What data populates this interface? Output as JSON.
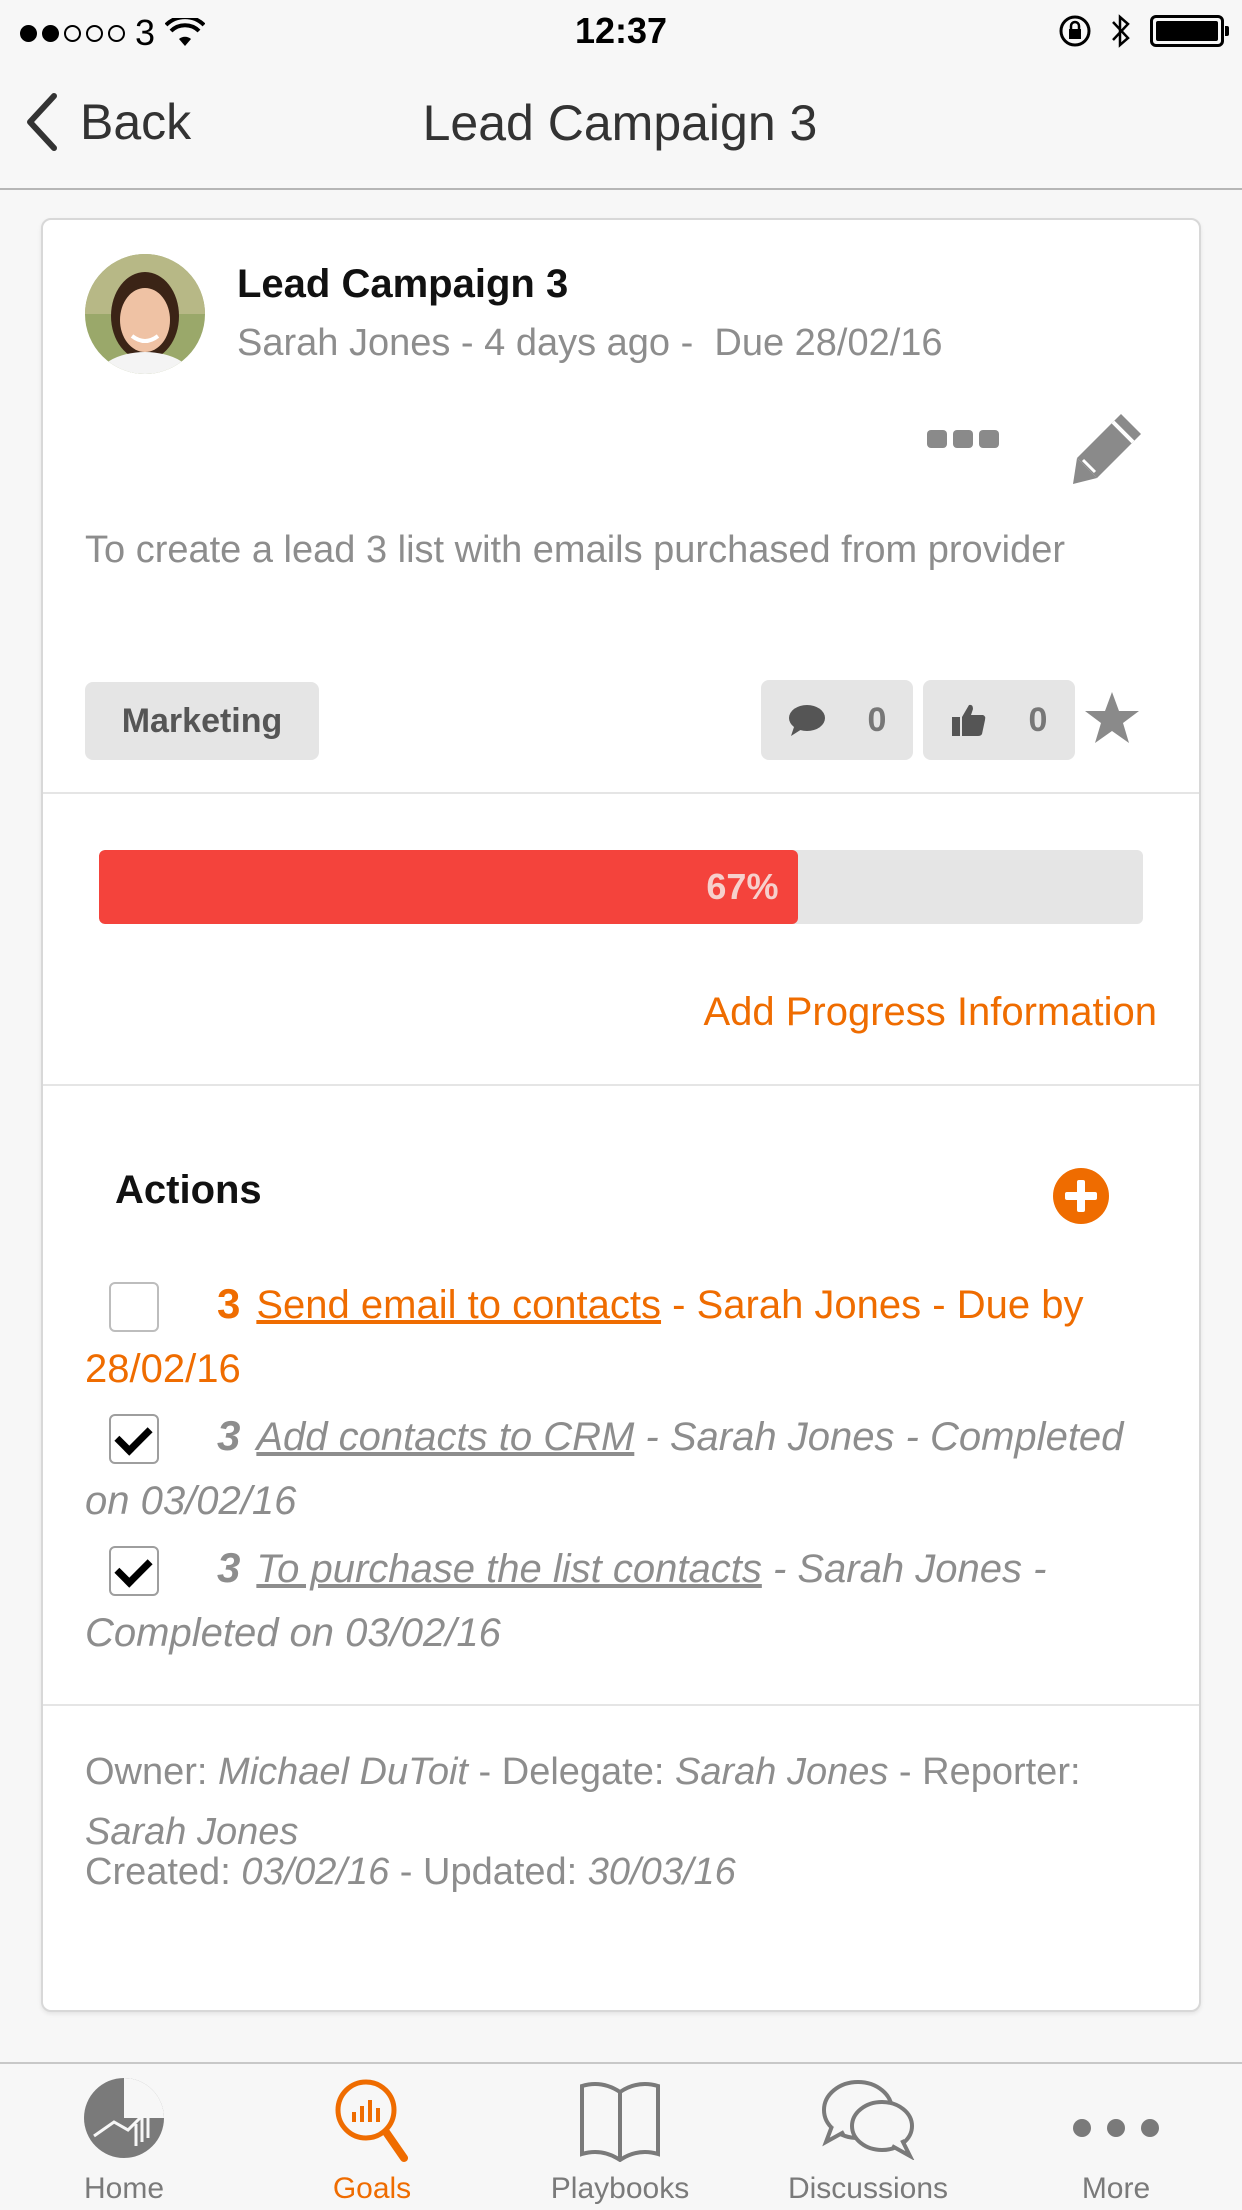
{
  "status_bar": {
    "carrier": "3",
    "time": "12:37"
  },
  "nav": {
    "back_label": "Back",
    "title": "Lead Campaign 3"
  },
  "goal": {
    "title": "Lead Campaign 3",
    "meta": "Sarah Jones - 4 days ago -  Due 28/02/16",
    "description": "To create a lead 3 list with emails purchased from provider",
    "tag": "Marketing",
    "comment_count": "0",
    "like_count": "0",
    "progress": {
      "percent": 67,
      "label": "67%"
    },
    "add_progress_label": "Add Progress Information"
  },
  "actions": {
    "title": "Actions",
    "items": [
      {
        "number": "3",
        "title": "Send email to contacts",
        "detail": " - Sarah Jones - Due by 28/02/16",
        "checked": false
      },
      {
        "number": "3",
        "title": "Add contacts to CRM",
        "detail": " - Sarah Jones - Completed on 03/02/16",
        "checked": true
      },
      {
        "number": "3",
        "title": "To purchase the list contacts",
        "detail": " - Sarah Jones - Completed on 03/02/16",
        "checked": true
      }
    ]
  },
  "people": {
    "owner_label": "Owner: ",
    "owner": "Michael DuToit",
    "delegate_label": " - Delegate: ",
    "delegate": "Sarah Jones",
    "reporter_label": " - Reporter: ",
    "reporter": "Sarah Jones"
  },
  "dates": {
    "created_label": "Created: ",
    "created": "03/02/16",
    "updated_label": " - Updated: ",
    "updated": "30/03/16"
  },
  "tabs": [
    {
      "label": "Home",
      "icon": "home-chart-icon",
      "active": false
    },
    {
      "label": "Goals",
      "icon": "goals-search-icon",
      "active": true
    },
    {
      "label": "Playbooks",
      "icon": "book-icon",
      "active": false
    },
    {
      "label": "Discussions",
      "icon": "chat-bubbles-icon",
      "active": false
    },
    {
      "label": "More",
      "icon": "more-dots-icon",
      "active": false
    }
  ],
  "colors": {
    "accent": "#ef6c00",
    "progress": "#f4433c",
    "muted_text": "#8d8d8d"
  }
}
